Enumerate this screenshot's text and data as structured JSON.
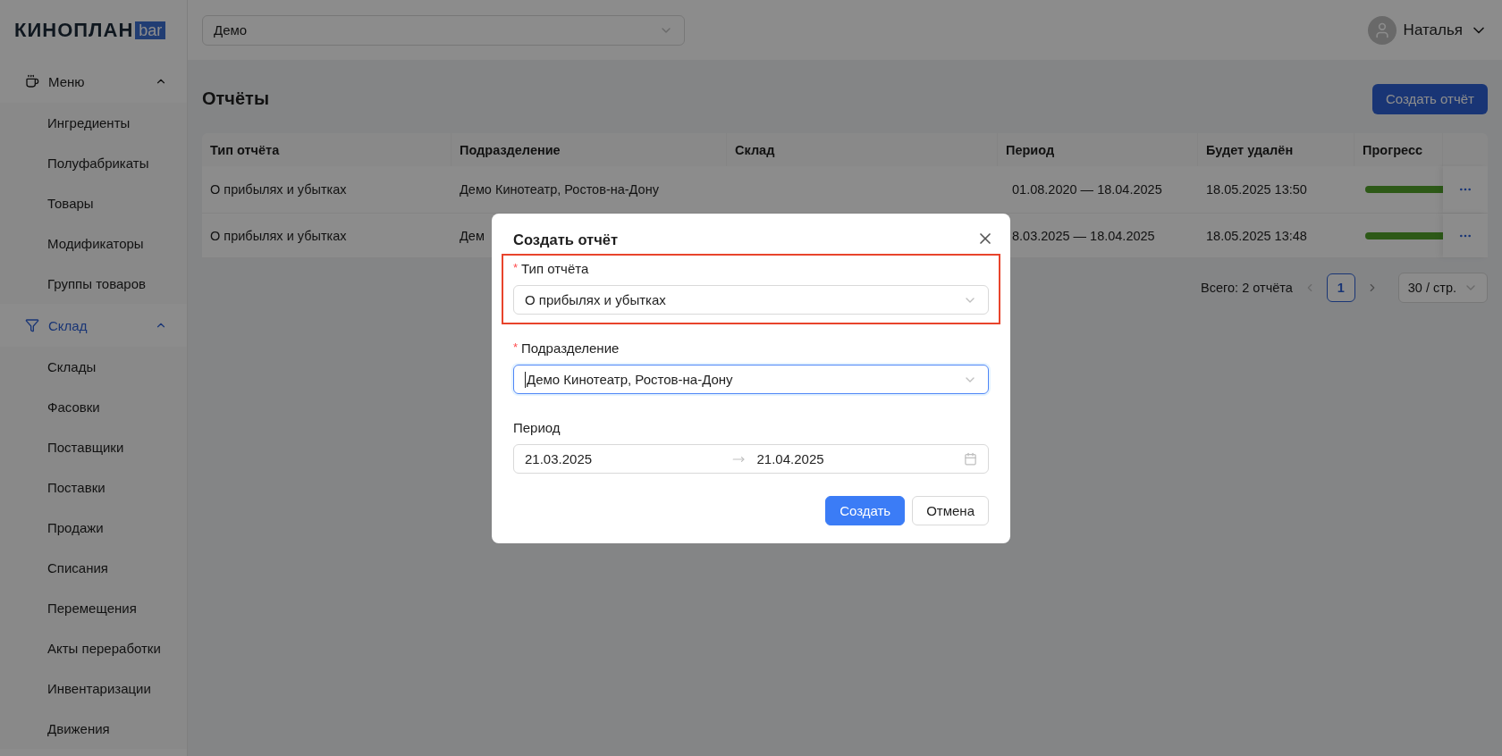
{
  "logo": {
    "text": "КИНОПЛАН",
    "badge": "bar"
  },
  "sidebar": {
    "groups": [
      {
        "label": "Меню",
        "expanded": true,
        "selected": false,
        "children": [
          {
            "label": "Ингредиенты"
          },
          {
            "label": "Полуфабрикаты"
          },
          {
            "label": "Товары"
          },
          {
            "label": "Модификаторы"
          },
          {
            "label": "Группы товаров"
          }
        ]
      },
      {
        "label": "Склад",
        "expanded": true,
        "selected": true,
        "children": [
          {
            "label": "Склады"
          },
          {
            "label": "Фасовки"
          },
          {
            "label": "Поставщики"
          },
          {
            "label": "Поставки"
          },
          {
            "label": "Продажи"
          },
          {
            "label": "Списания"
          },
          {
            "label": "Перемещения"
          },
          {
            "label": "Акты переработки"
          },
          {
            "label": "Инвентаризации"
          },
          {
            "label": "Движения"
          }
        ]
      }
    ]
  },
  "topbar": {
    "organization_select": {
      "value": "Демо"
    },
    "user": {
      "name": "Наталья"
    }
  },
  "page": {
    "title": "Отчёты",
    "create_button": "Создать отчёт"
  },
  "table": {
    "columns": [
      "Тип отчёта",
      "Подразделение",
      "Склад",
      "Период",
      "Будет удалён",
      "Прогресс"
    ],
    "rows": [
      {
        "report_type": "О прибылях и убытках",
        "division": "Демо Кинотеатр, Ростов-на-Дону",
        "period": "01.08.2020 — 18.04.2025",
        "deleted_at": "18.05.2025 13:50",
        "progress": {
          "level": 1
        }
      },
      {
        "report_type": "О прибылях и убытках",
        "division": "Дем",
        "period": "8.03.2025 — 18.04.2025",
        "deleted_at": "18.05.2025 13:48",
        "progress": {
          "level": 1
        }
      }
    ]
  },
  "pagination": {
    "total": "Всего: 2 отчёта",
    "pages": [
      {
        "label": "1",
        "selected": true
      }
    ],
    "page_size": "30 / стр."
  },
  "modal": {
    "title": "Создать отчёт",
    "fields": [
      {
        "kind": "select",
        "label": "Тип отчёта",
        "required_mark": "*",
        "value": "О прибылях и убытках",
        "focused": false,
        "highlighted": true
      },
      {
        "kind": "select",
        "label": "Подразделение",
        "required_mark": "*",
        "value": "Демо Кинотеатр, Ростов-на-Дону",
        "focused": true,
        "highlighted": false
      },
      {
        "kind": "daterange",
        "label": "Период",
        "start": "21.03.2025",
        "end": "21.04.2025",
        "focused": false,
        "highlighted": false
      }
    ],
    "buttons": [
      {
        "label": "Создать",
        "kind": "primary"
      },
      {
        "label": "Отмена",
        "kind": "default"
      }
    ]
  }
}
